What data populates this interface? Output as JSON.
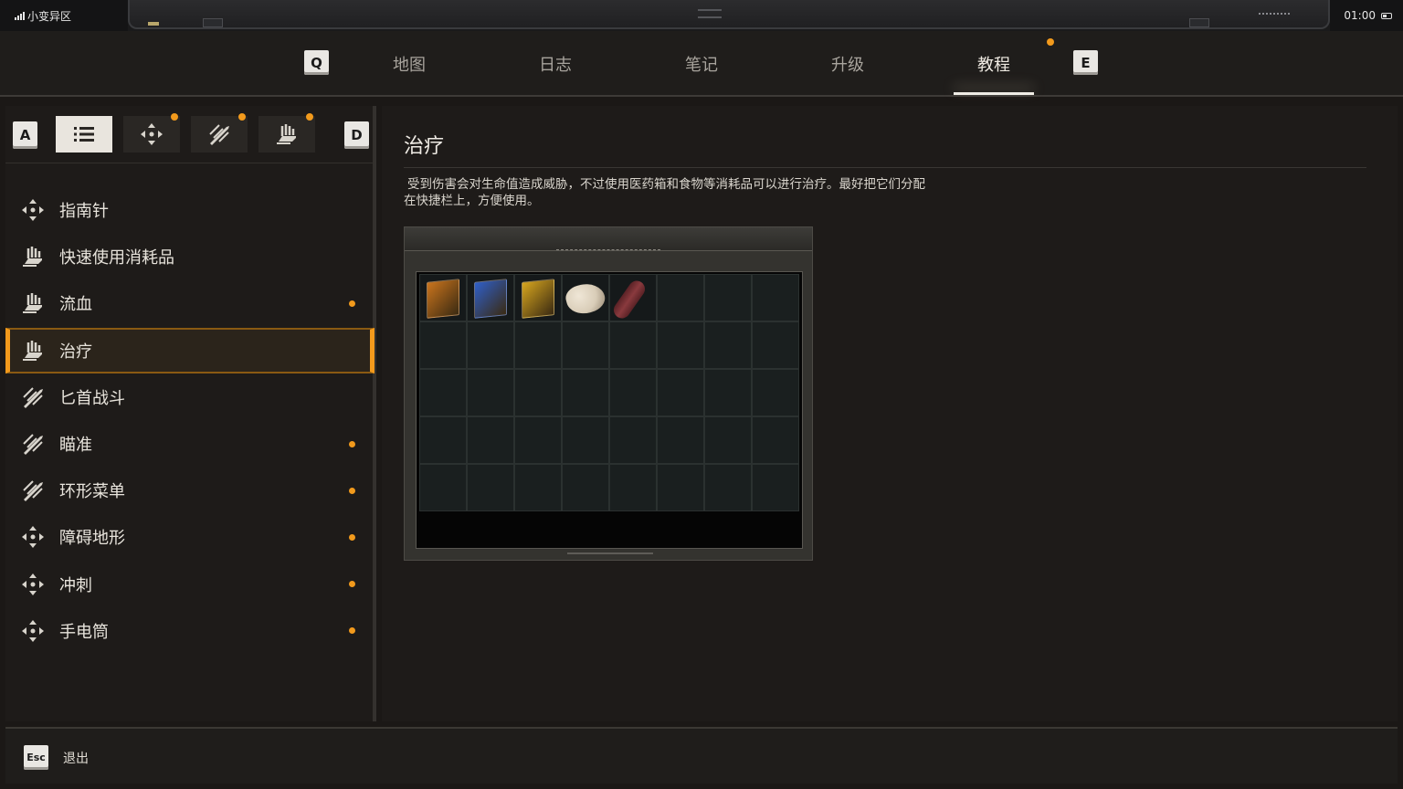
{
  "status_bar": {
    "carrier": "小变异区",
    "time": "01:00"
  },
  "tabs": {
    "prev_key": "Q",
    "next_key": "E",
    "items": [
      {
        "label": "地图",
        "active": false
      },
      {
        "label": "日志",
        "active": false
      },
      {
        "label": "笔记",
        "active": false
      },
      {
        "label": "升级",
        "active": false
      },
      {
        "label": "教程",
        "active": true,
        "has_notification": true
      }
    ]
  },
  "category_bar": {
    "prev_key": "A",
    "next_key": "D",
    "categories": [
      {
        "icon": "list-icon",
        "active": true,
        "has_notification": false
      },
      {
        "icon": "compass-icon",
        "active": false,
        "has_notification": true
      },
      {
        "icon": "knife-icon",
        "active": false,
        "has_notification": true
      },
      {
        "icon": "hand-icon",
        "active": false,
        "has_notification": true
      }
    ]
  },
  "tutorial_list": [
    {
      "label": "指南针",
      "icon": "compass-icon",
      "new": false,
      "selected": false
    },
    {
      "label": "快速使用消耗品",
      "icon": "hand-icon",
      "new": false,
      "selected": false
    },
    {
      "label": "流血",
      "icon": "hand-icon",
      "new": true,
      "selected": false
    },
    {
      "label": "治疗",
      "icon": "hand-icon",
      "new": false,
      "selected": true
    },
    {
      "label": "匕首战斗",
      "icon": "knife-icon",
      "new": false,
      "selected": false
    },
    {
      "label": "瞄准",
      "icon": "knife-icon",
      "new": true,
      "selected": false
    },
    {
      "label": "环形菜单",
      "icon": "knife-icon",
      "new": true,
      "selected": false
    },
    {
      "label": "障碍地形",
      "icon": "compass-icon",
      "new": true,
      "selected": false
    },
    {
      "label": "冲刺",
      "icon": "compass-icon",
      "new": true,
      "selected": false
    },
    {
      "label": "手电筒",
      "icon": "compass-icon",
      "new": true,
      "selected": false
    }
  ],
  "detail": {
    "title": "治疗",
    "description_line1": "受到伤害会对生命值造成威胁，不过使用医药箱和食物等消耗品可以进行治疗。最好把它们分配",
    "description_line2": "在快捷栏上，方便使用。",
    "inventory_items": [
      {
        "name": "orange-medkit-icon",
        "color": "#c9741d"
      },
      {
        "name": "blue-medkit-icon",
        "color": "#2f5fc8"
      },
      {
        "name": "yellow-medkit-icon",
        "color": "#d6a51e"
      },
      {
        "name": "bread-icon",
        "color": "#d9cdb8"
      },
      {
        "name": "sausage-icon",
        "color": "#8a3a3e"
      }
    ]
  },
  "footer": {
    "esc_key": "Esc",
    "exit_label": "退出"
  },
  "colors": {
    "accent": "#f39a1c",
    "panel_bg": "#1e1b19",
    "text": "#e8e4dc"
  }
}
